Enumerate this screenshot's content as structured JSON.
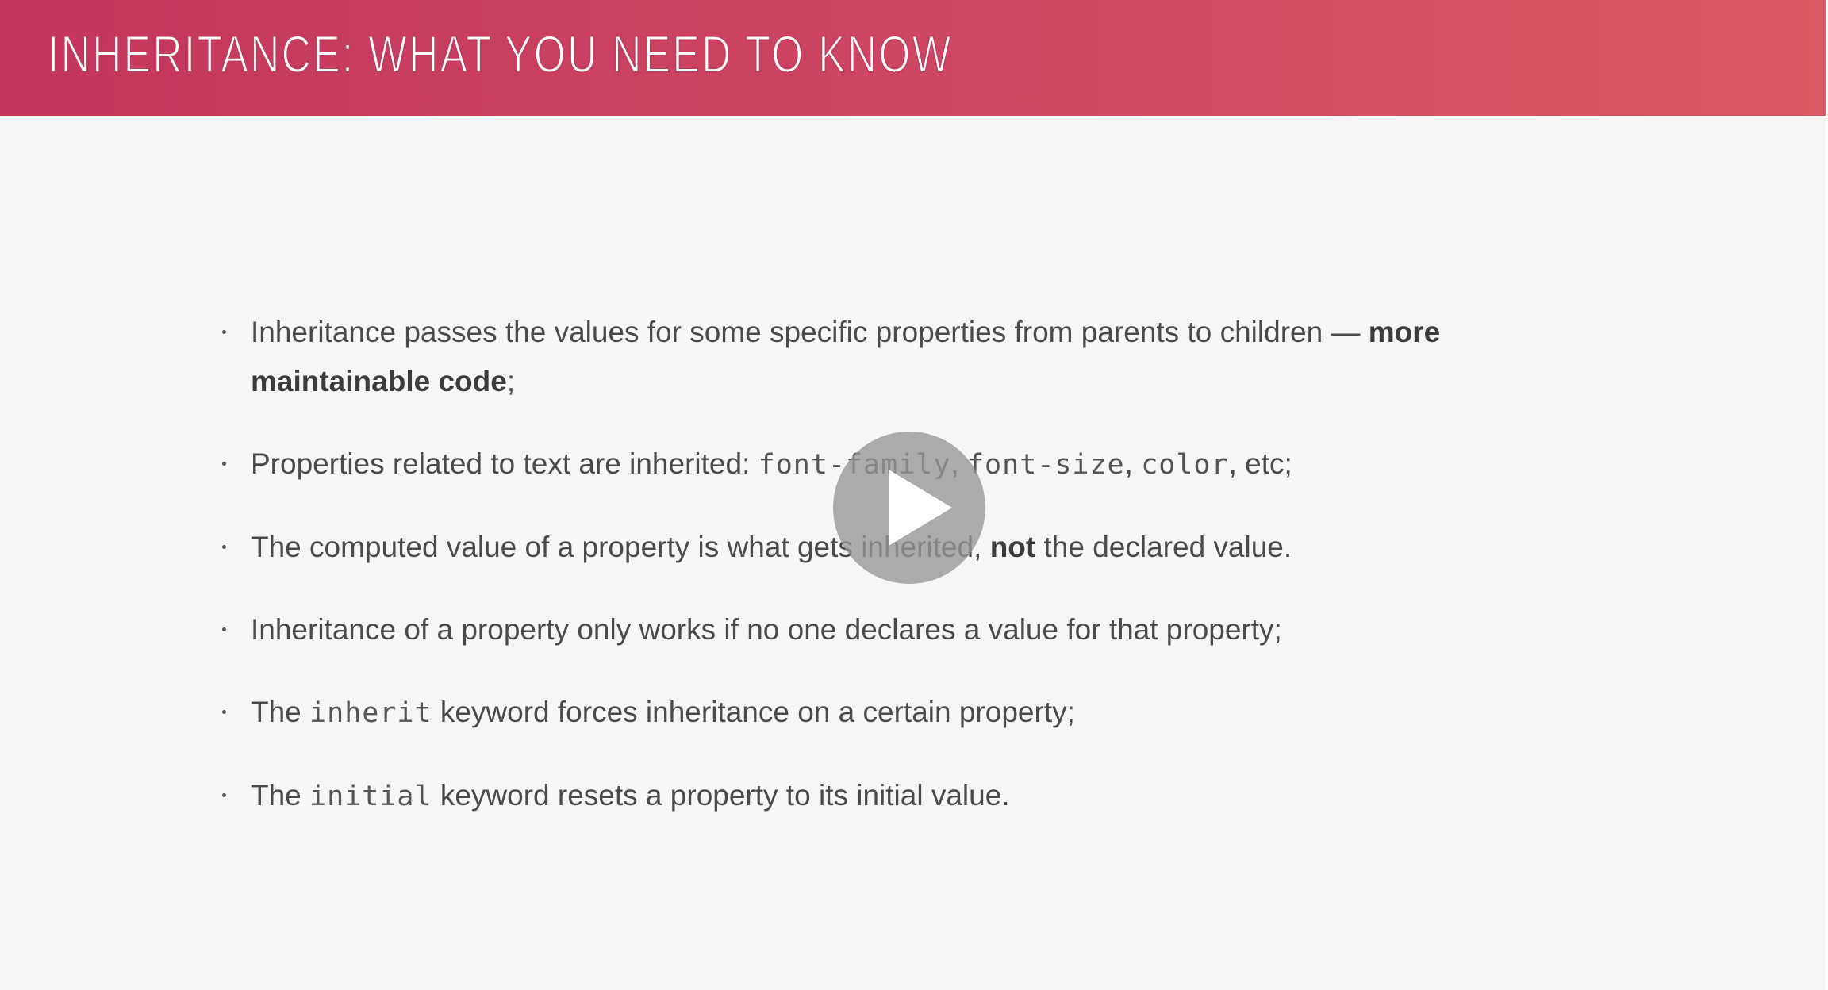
{
  "header": {
    "title": "INHERITANCE: WHAT YOU NEED TO KNOW"
  },
  "bullets": [
    {
      "segments": [
        {
          "text": "Inheritance passes the values for some specific properties from parents to children — ",
          "style": "normal"
        },
        {
          "text": "more maintainable code",
          "style": "bold"
        },
        {
          "text": ";",
          "style": "normal"
        }
      ]
    },
    {
      "segments": [
        {
          "text": "Properties related to text are inherited: ",
          "style": "normal"
        },
        {
          "text": "font-family",
          "style": "code"
        },
        {
          "text": ", ",
          "style": "normal"
        },
        {
          "text": "font-size",
          "style": "code"
        },
        {
          "text": ", ",
          "style": "normal"
        },
        {
          "text": "color",
          "style": "code"
        },
        {
          "text": ", etc;",
          "style": "normal"
        }
      ]
    },
    {
      "segments": [
        {
          "text": "The computed value of a property is what gets inherited, ",
          "style": "normal"
        },
        {
          "text": "not",
          "style": "bold"
        },
        {
          "text": " the declared value.",
          "style": "normal"
        }
      ]
    },
    {
      "segments": [
        {
          "text": "Inheritance of a property only works if no one declares a value for that property;",
          "style": "normal"
        }
      ]
    },
    {
      "segments": [
        {
          "text": "The ",
          "style": "normal"
        },
        {
          "text": "inherit",
          "style": "code"
        },
        {
          "text": " keyword forces inheritance on a certain property;",
          "style": "normal"
        }
      ]
    },
    {
      "segments": [
        {
          "text": "The ",
          "style": "normal"
        },
        {
          "text": "initial",
          "style": "code"
        },
        {
          "text": " keyword resets a property to its initial value.",
          "style": "normal"
        }
      ]
    }
  ],
  "video": {
    "play_icon": "play-icon",
    "overlay_color": "#969696"
  },
  "colors": {
    "header_gradient_start": "#c3355b",
    "header_gradient_end": "#db5965",
    "slide_background": "#f6f6f6",
    "body_text": "#4a4a4a"
  }
}
